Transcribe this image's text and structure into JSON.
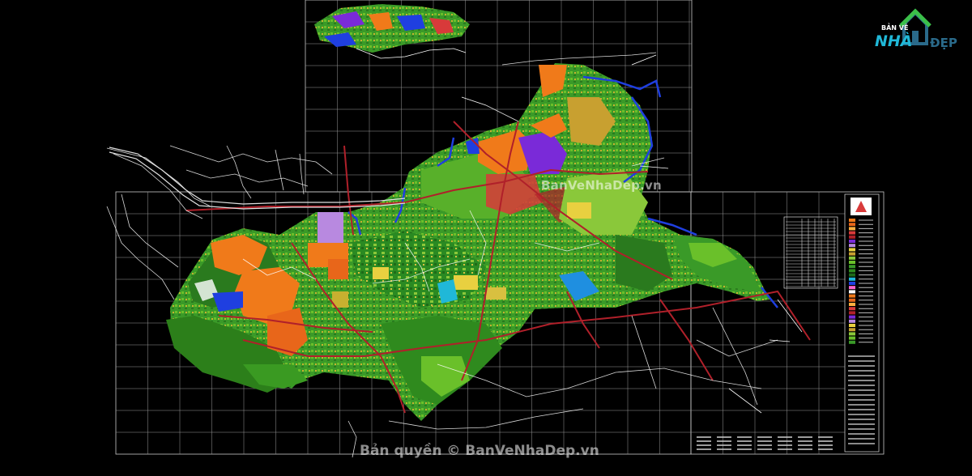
{
  "watermark": {
    "center_text": "BanVeNhaDep.vn",
    "bottom_text": "Bản quyền © BanVeNhaDep.vn"
  },
  "logo": {
    "top_text": "BẢN VẼ",
    "main_text": "NHÀ",
    "sub_text": "ĐẸP",
    "icon": "house-icon",
    "colors": {
      "brand_blue": "#20b8d8",
      "brand_green": "#3bbf4a",
      "brand_dark": "#2a6a8a"
    }
  },
  "colors": {
    "background": "#000000",
    "grid": "#c8c8c8",
    "road_main": "#b0202a",
    "road_secondary": "#ffffff",
    "water": "#1f3fe0",
    "forest": "#2f8a1e",
    "agriculture": "#6ab82a",
    "residential": "#f07a1a",
    "industrial": "#7a2ad8",
    "public": "#d83a3a",
    "mixed": "#b8a030"
  }
}
